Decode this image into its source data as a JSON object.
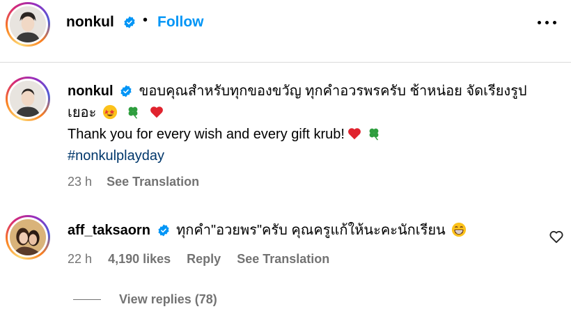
{
  "header": {
    "username": "nonkul",
    "dot": "•",
    "follow_label": "Follow",
    "more_icon": "more-horizontal-icon"
  },
  "caption": {
    "username": "nonkul",
    "thai_text": "ขอบคุณสำหรับทุกของขวัญ ทุกคำอวรพรครับ ช้าหน่อย จัดเรียงรูปเยอะ",
    "english_text": "Thank you for every wish and every gift krub!",
    "hashtag": "#nonkulplayday",
    "time": "23 h",
    "see_translation": "See Translation",
    "emojis": [
      "star-struck-face",
      "four-leaf-clover",
      "red-heart"
    ]
  },
  "comment": {
    "username": "aff_taksaorn",
    "text": "ทุกคำ\"อวยพร\"ครับ คุณครูแก้ให้นะคะนักเรียน",
    "emoji": "grinning-face",
    "time": "22 h",
    "likes": "4,190 likes",
    "reply_label": "Reply",
    "see_translation": "See Translation",
    "view_replies": "View replies (78)"
  },
  "colors": {
    "accent": "#0095f6",
    "muted": "#737373",
    "hashtag": "#00376b",
    "verified": "#0095f6",
    "divider": "#dbdbdb"
  }
}
